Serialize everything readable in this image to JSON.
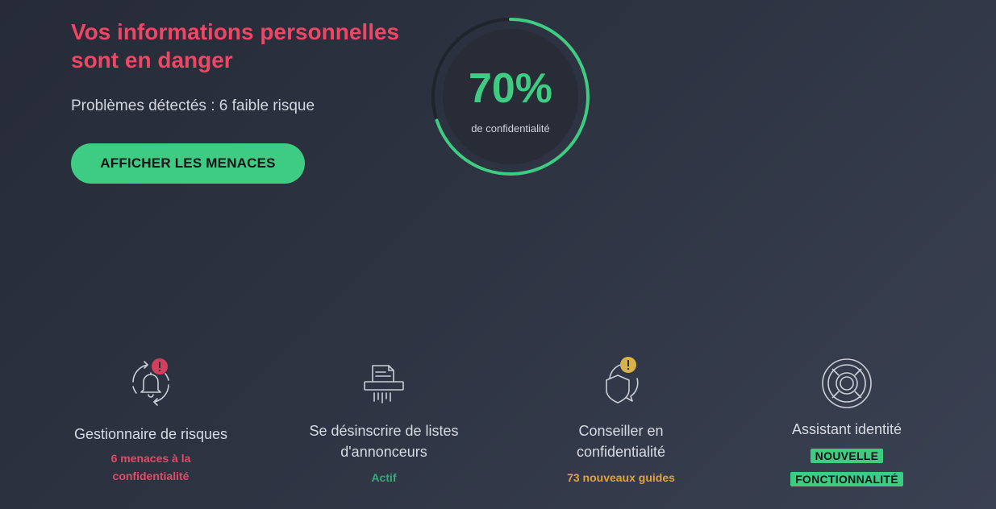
{
  "hero": {
    "headline": "Vos informations personnelles sont en danger",
    "subline": "Problèmes détectés : 6 faible risque",
    "cta_label": "AFFICHER LES MENACES"
  },
  "gauge": {
    "value_label": "70%",
    "caption": "de confidentialité",
    "percent": 70
  },
  "features": [
    {
      "title": "Gestionnaire de risques",
      "status_line1": "6 menaces à la",
      "status_line2": "confidentialité",
      "icon": "bell-cycle-icon",
      "alert_icon": "alert-badge-icon"
    },
    {
      "title_line1": "Se désinscrire de listes",
      "title_line2": "d'annonceurs",
      "status": "Actif",
      "icon": "shredder-icon"
    },
    {
      "title_line1": "Conseiller en",
      "title_line2": "confidentialité",
      "status": "73 nouveaux guides",
      "icon": "shield-chat-icon",
      "alert_icon": "warning-badge-icon"
    },
    {
      "title": "Assistant identité",
      "badge_line1": "NOUVELLE",
      "badge_line2": "FONCTIONNALITÉ",
      "icon": "lifebuoy-icon"
    }
  ],
  "colors": {
    "danger": "#ee4664",
    "accent": "#3ecb82",
    "warning": "#e2a23c",
    "alert_red": "#d2405e",
    "alert_yellow": "#d8b24a"
  }
}
